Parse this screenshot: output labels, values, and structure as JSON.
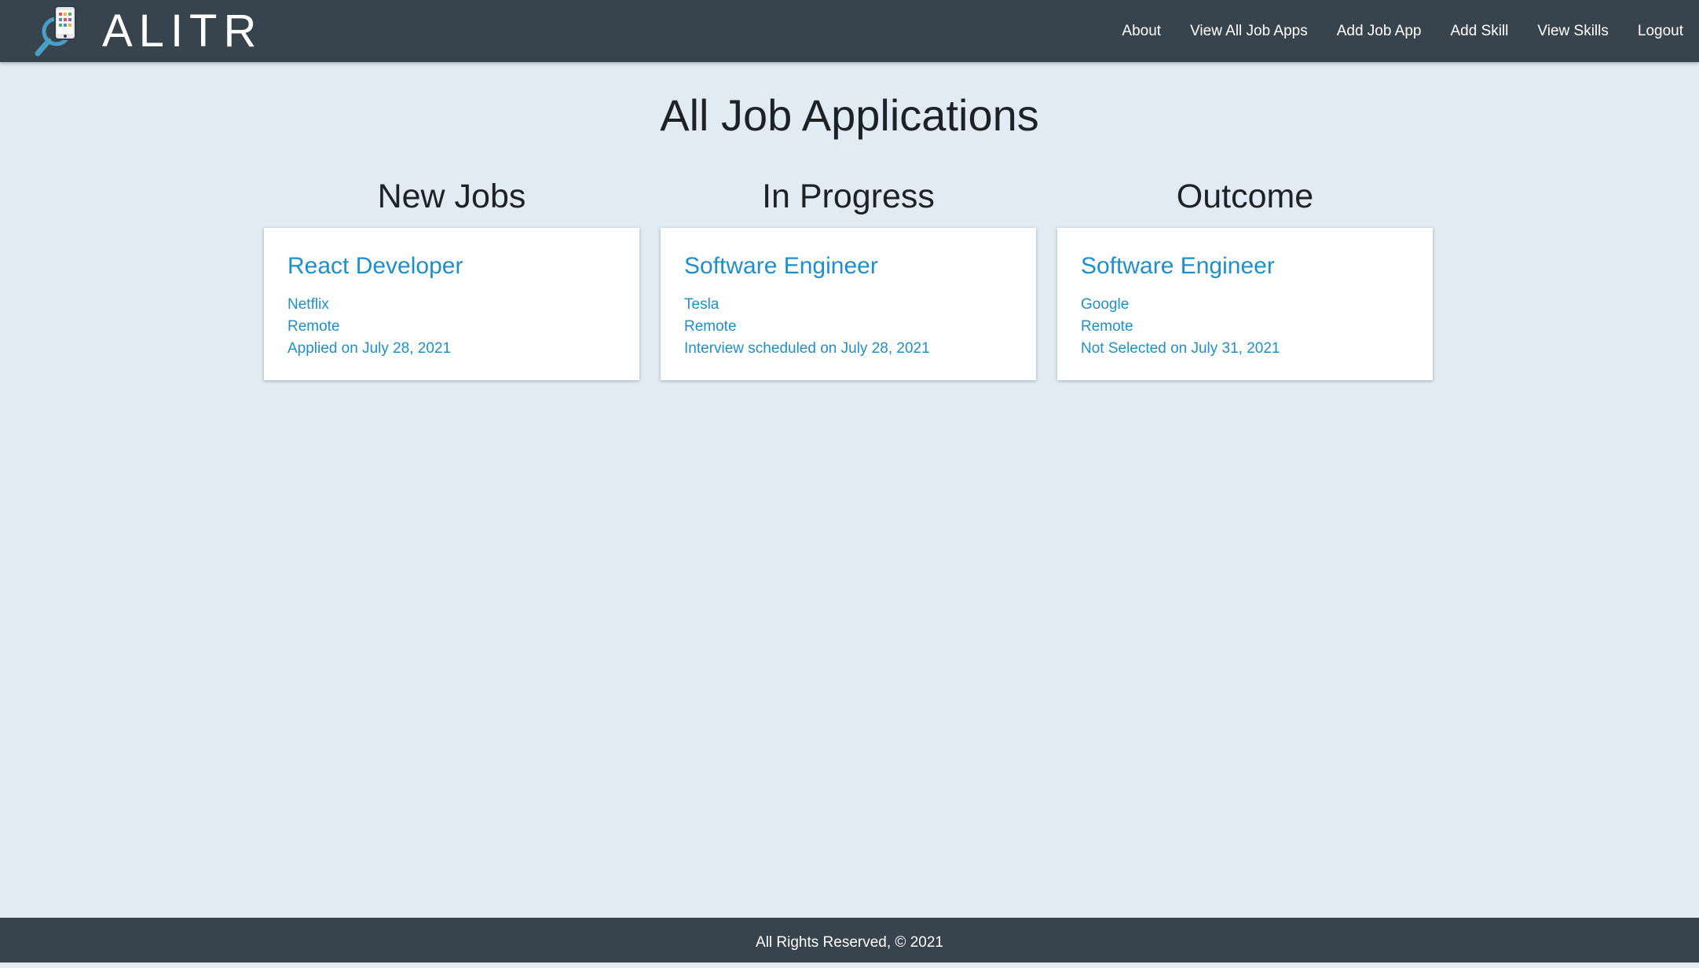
{
  "navbar": {
    "brand": "ALITR",
    "logo_icon": "phone-magnifier-icon",
    "links": [
      {
        "label": "About"
      },
      {
        "label": "View All Job Apps"
      },
      {
        "label": "Add Job App"
      },
      {
        "label": "Add Skill"
      },
      {
        "label": "View Skills"
      },
      {
        "label": "Logout"
      }
    ]
  },
  "page": {
    "title": "All Job Applications"
  },
  "columns": [
    {
      "title": "New Jobs",
      "cards": [
        {
          "title": "React Developer",
          "company": "Netflix",
          "location": "Remote",
          "status": "Applied on July 28, 2021"
        }
      ]
    },
    {
      "title": "In Progress",
      "cards": [
        {
          "title": "Software Engineer",
          "company": "Tesla",
          "location": "Remote",
          "status": "Interview scheduled on July 28, 2021"
        }
      ]
    },
    {
      "title": "Outcome",
      "cards": [
        {
          "title": "Software Engineer",
          "company": "Google",
          "location": "Remote",
          "status": "Not Selected on July 31, 2021"
        }
      ]
    }
  ],
  "footer": {
    "text": "All Rights Reserved, © 2021"
  },
  "colors": {
    "navbar_bg": "#38444d",
    "page_bg": "#e1ebf4",
    "accent": "#1e8fca"
  }
}
